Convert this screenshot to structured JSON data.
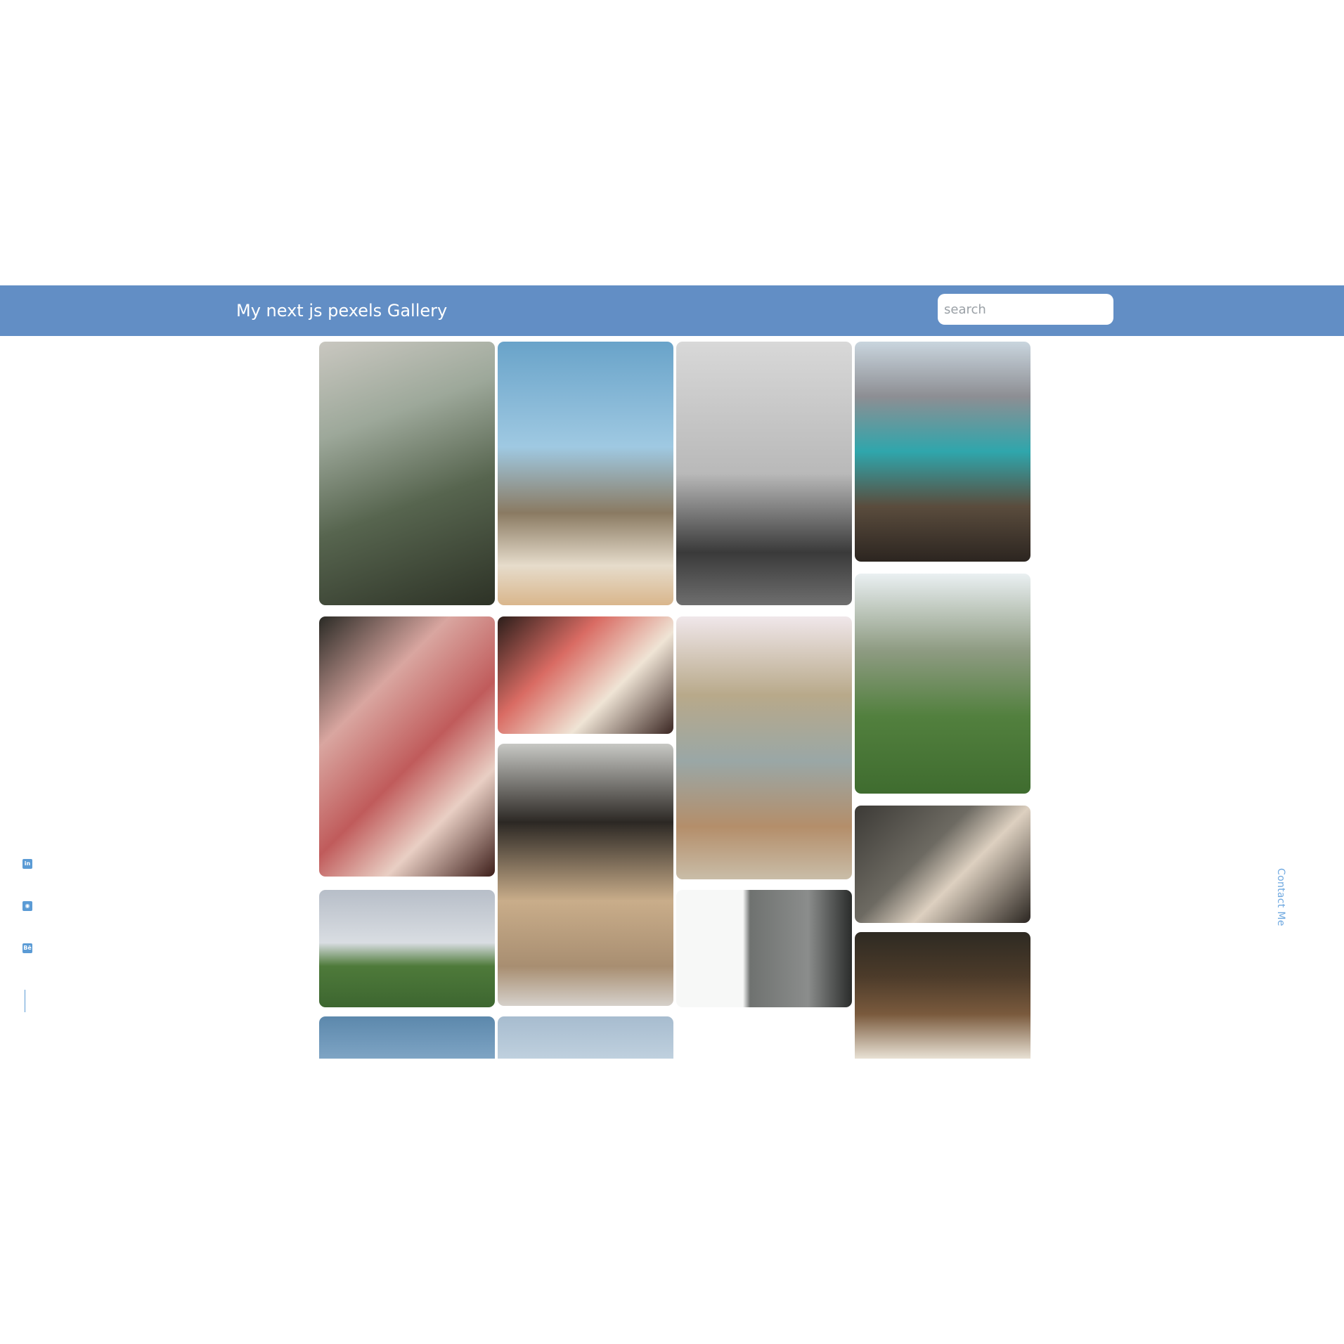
{
  "header": {
    "title": "My next js pexels Gallery",
    "search_placeholder": "search",
    "search_value": "",
    "bar_color": "#628ec5"
  },
  "gallery": {
    "photos": [
      {
        "name": "photo-man-in-suit",
        "bg": "linear-gradient(160deg,#c9c7c0 0%,#9da89a 30%,#57654f 60%,#2d3226 100%)"
      },
      {
        "name": "photo-lifeguard-pier",
        "bg": "linear-gradient(180deg,#69a3c9 0%,#9fc9e2 40%,#8a7a62 65%,#e6dccb 85%,#d9b68c 100%)"
      },
      {
        "name": "photo-bw-woman-mirror",
        "bg": "linear-gradient(180deg,#d8d8d8 0%,#b9b9b9 50%,#3a3a3a 80%,#6e6e6e 100%)"
      },
      {
        "name": "photo-crater-lake",
        "bg": "linear-gradient(180deg,#c9d5de 0%,#8d8e93 25%,#2fa6ac 50%,#5a4c3d 75%,#2c2520 100%)"
      },
      {
        "name": "photo-drink-on-pillow",
        "bg": "linear-gradient(135deg,#2a2a25 0%,#d9a6a0 30%,#c05b5b 55%,#e9cfc4 75%,#3d1e1a 100%)"
      },
      {
        "name": "photo-drink-with-book",
        "bg": "linear-gradient(135deg,#2b1e1a 0%,#d96b63 35%,#efe4d5 65%,#3a2622 100%)"
      },
      {
        "name": "photo-woman-flowers-road",
        "bg": "linear-gradient(180deg,#f0e7ea 0%,#b8a98a 30%,#9aa7a6 55%,#b48e6a 80%,#c9bda8 100%)"
      },
      {
        "name": "photo-palm-trees",
        "bg": "linear-gradient(180deg,#eaf0f2 0%,#8e9b82 35%,#52803e 65%,#3f6c2f 100%)"
      },
      {
        "name": "photo-woman-headphones-coat",
        "bg": "linear-gradient(180deg,#c7c8c4 0%,#2c2824 30%,#c9ad8a 60%,#a88e71 85%,#d5d0ca 100%)"
      },
      {
        "name": "photo-woman-stairs-coffee",
        "bg": "linear-gradient(135deg,#3c3a36 0%,#6d6a62 40%,#ddd0c0 60%,#2b2621 100%)"
      },
      {
        "name": "photo-field-running-girl",
        "bg": "linear-gradient(180deg,#b7bec8 0%,#d9dde2 45%,#4e7a3a 65%,#3d6630 100%)"
      },
      {
        "name": "photo-bw-palms-hill",
        "bg": "linear-gradient(90deg,#f7f8f7 0%,#f7f8f7 38%,#6f7270 42%,#8b8d8c 75%,#2a2c2b 100%)"
      },
      {
        "name": "photo-curly-hair-woman",
        "bg": "linear-gradient(180deg,#2e2a22 0%,#4c3b2a 35%,#7a5a3d 65%,#e8e1d4 100%)"
      },
      {
        "name": "photo-blue-sky-1",
        "bg": "linear-gradient(180deg,#5c88ac 0%,#7ea4c4 100%)"
      },
      {
        "name": "photo-blue-sky-2",
        "bg": "linear-gradient(180deg,#a7bccf 0%,#bfd0de 100%)"
      }
    ]
  },
  "social": {
    "links": [
      {
        "icon": "linkedin-icon",
        "glyph": "in"
      },
      {
        "icon": "github-icon",
        "glyph": "◉"
      },
      {
        "icon": "behance-icon",
        "glyph": "Bē"
      }
    ],
    "color": "#5b9bd5"
  },
  "contact": {
    "label": "Contact Me",
    "color": "#6ea8e0"
  }
}
